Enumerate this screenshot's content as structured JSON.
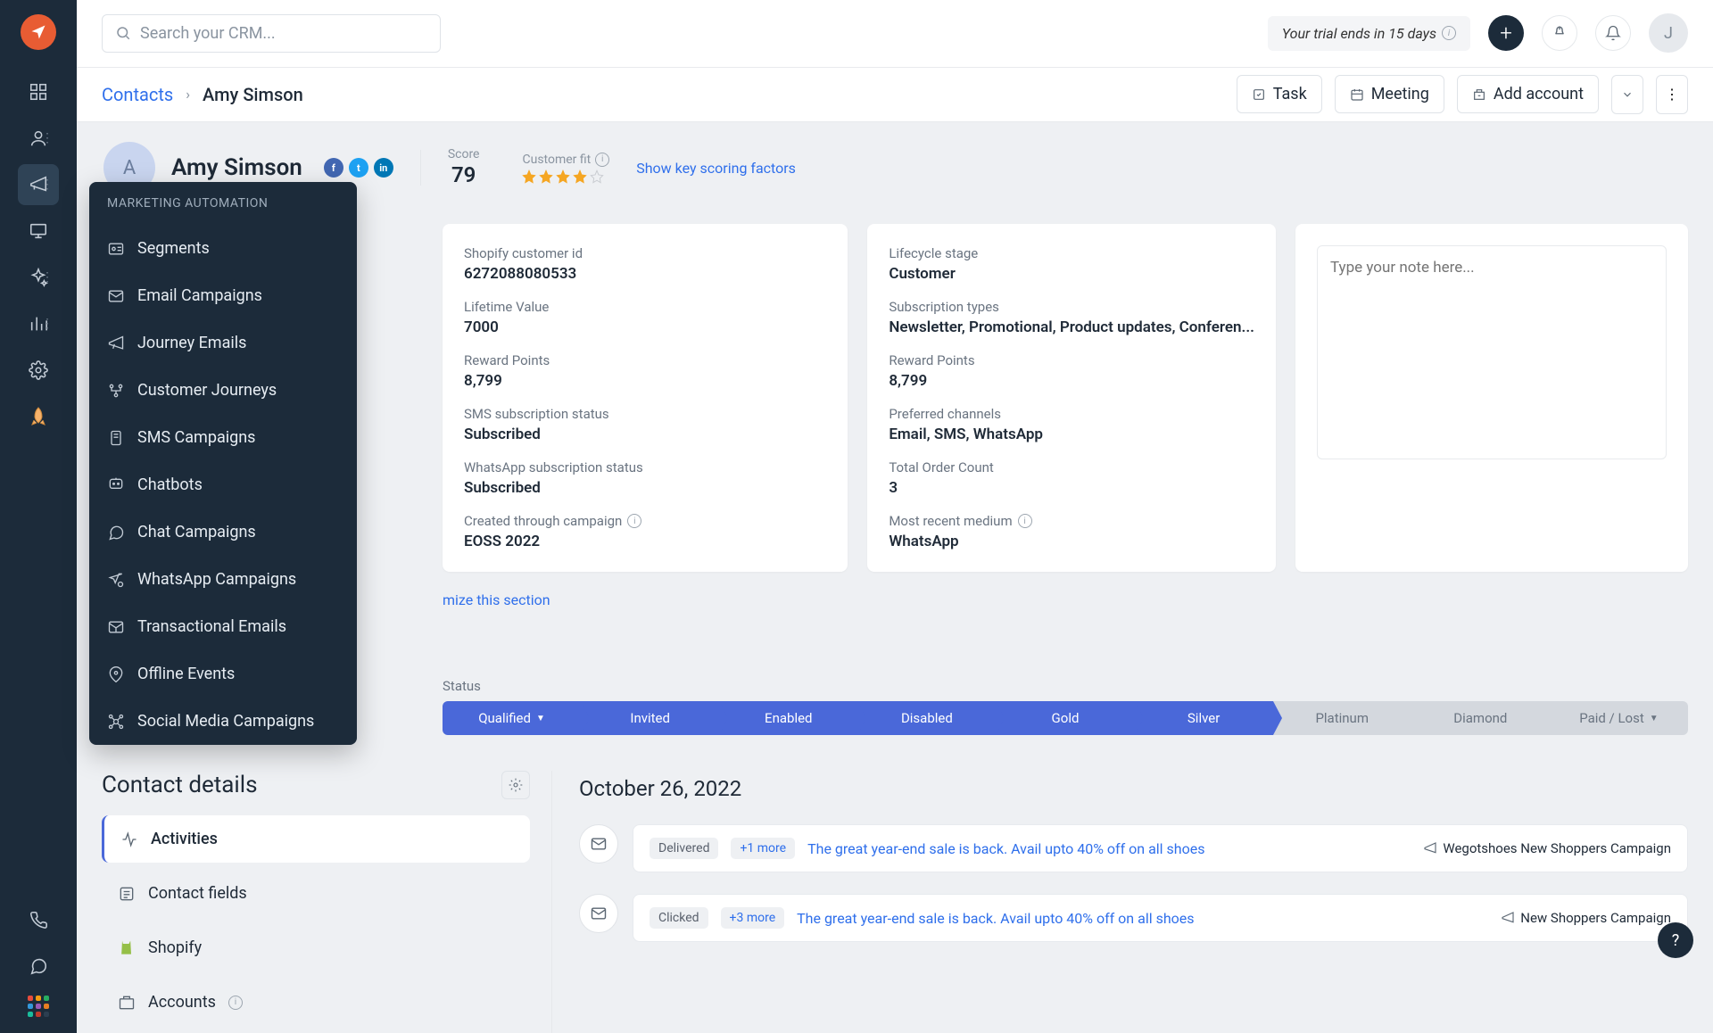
{
  "search": {
    "placeholder": "Search your CRM..."
  },
  "trial_text": "Your trial ends in 15 days",
  "avatar_initial": "J",
  "breadcrumb": {
    "root": "Contacts",
    "current": "Amy Simson"
  },
  "actions": {
    "task": "Task",
    "meeting": "Meeting",
    "add_account": "Add account"
  },
  "contact": {
    "name": "Amy Simson",
    "initial": "A",
    "score_label": "Score",
    "score": "79",
    "fit_label": "Customer fit",
    "stars_filled": 4,
    "scoring_link": "Show key scoring factors"
  },
  "flyout": {
    "title": "MARKETING AUTOMATION",
    "items": [
      "Segments",
      "Email Campaigns",
      "Journey Emails",
      "Customer Journeys",
      "SMS Campaigns",
      "Chatbots",
      "Chat Campaigns",
      "WhatsApp Campaigns",
      "Transactional Emails",
      "Offline Events",
      "Social Media Campaigns"
    ]
  },
  "card1": [
    {
      "label": "Shopify customer id",
      "value": "6272088080533"
    },
    {
      "label": "Lifetime Value",
      "value": "7000"
    },
    {
      "label": "Reward Points",
      "value": "8,799"
    },
    {
      "label": "SMS subscription status",
      "value": "Subscribed"
    },
    {
      "label": "WhatsApp subscription status",
      "value": "Subscribed"
    },
    {
      "label": "Created through campaign",
      "value": "EOSS 2022",
      "info": true
    }
  ],
  "card2": [
    {
      "label": "Lifecycle stage",
      "value": "Customer"
    },
    {
      "label": "Subscription types",
      "value": "Newsletter, Promotional, Product updates, Conferen..."
    },
    {
      "label": "Reward Points",
      "value": "8,799"
    },
    {
      "label": "Preferred channels",
      "value": "Email, SMS, WhatsApp"
    },
    {
      "label": "Total Order Count",
      "value": "3"
    },
    {
      "label": "Most recent medium",
      "value": "WhatsApp",
      "info": true
    }
  ],
  "note_placeholder": "Type your note here...",
  "customize_link": "mize this section",
  "status_label": "Status",
  "pipeline": [
    {
      "label": "Qualified",
      "active": true,
      "dropdown": true
    },
    {
      "label": "Invited",
      "active": true
    },
    {
      "label": "Enabled",
      "active": true
    },
    {
      "label": "Disabled",
      "active": true
    },
    {
      "label": "Gold",
      "active": true
    },
    {
      "label": "Silver",
      "active": true
    },
    {
      "label": "Platinum",
      "active": false
    },
    {
      "label": "Diamond",
      "active": false
    },
    {
      "label": "Paid / Lost",
      "active": false,
      "dropdown": true
    }
  ],
  "details": {
    "title": "Contact details",
    "tabs": [
      "Activities",
      "Contact fields",
      "Shopify",
      "Accounts"
    ]
  },
  "timeline": {
    "date": "October 26, 2022",
    "rows": [
      {
        "tag": "Delivered",
        "more": "+1 more",
        "subject": "The great year-end sale is back. Avail upto 40% off on all shoes",
        "campaign": "Wegotshoes New Shoppers Campaign"
      },
      {
        "tag": "Clicked",
        "more": "+3 more",
        "subject": "The great year-end sale is back. Avail upto 40% off on all shoes",
        "campaign": "New Shoppers Campaign"
      }
    ]
  }
}
